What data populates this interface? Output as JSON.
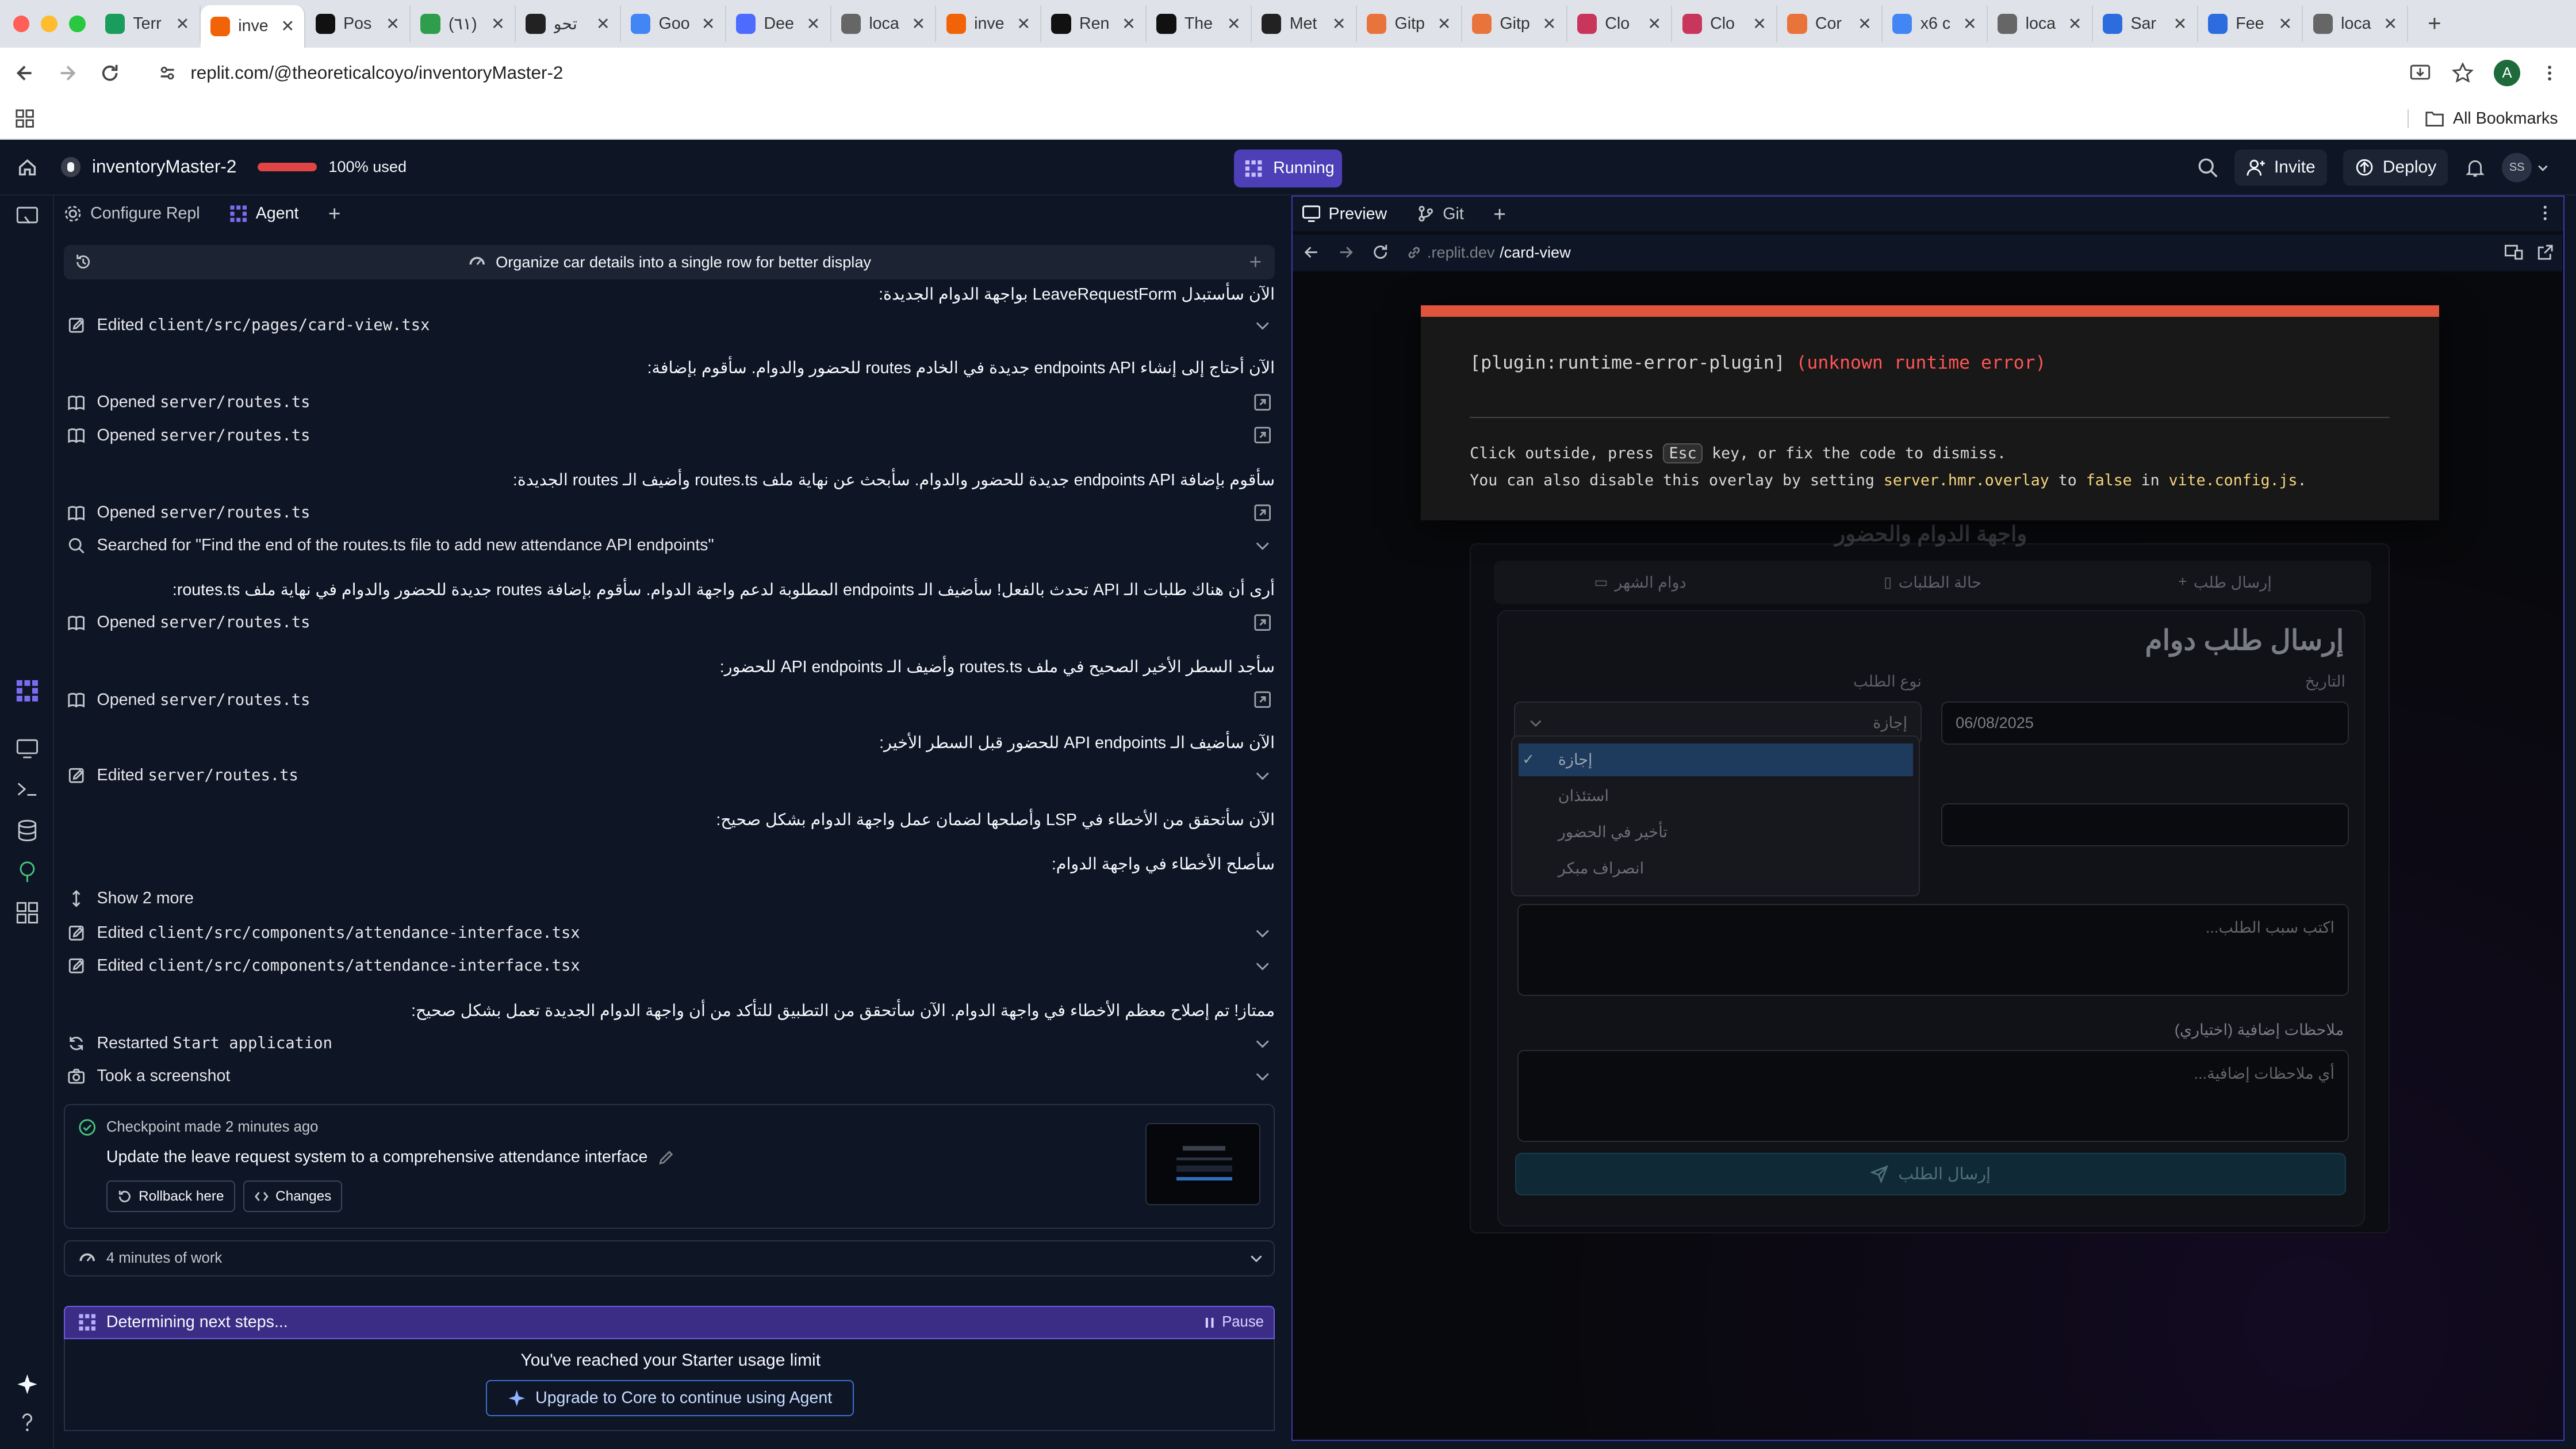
{
  "browser": {
    "tabs": [
      {
        "label": "Terr",
        "color": "#1a9d5c"
      },
      {
        "label": "inve",
        "color": "#f26207",
        "active": true
      },
      {
        "label": "Pos",
        "color": "#111111"
      },
      {
        "label": "(٦١)",
        "color": "#2e9e4c"
      },
      {
        "label": "تحو",
        "color": "#222222"
      },
      {
        "label": "Goo",
        "color": "#4285f4"
      },
      {
        "label": "Dee",
        "color": "#4d6bfe"
      },
      {
        "label": "loca",
        "color": "#666666"
      },
      {
        "label": "inve",
        "color": "#f26207"
      },
      {
        "label": "Ren",
        "color": "#111111"
      },
      {
        "label": "The",
        "color": "#111111"
      },
      {
        "label": "Met",
        "color": "#222222"
      },
      {
        "label": "Gitp",
        "color": "#e8743b"
      },
      {
        "label": "Gitp",
        "color": "#e8743b"
      },
      {
        "label": "Clo",
        "color": "#c8365b"
      },
      {
        "label": "Clo",
        "color": "#c8365b"
      },
      {
        "label": "Cor",
        "color": "#e8743b"
      },
      {
        "label": "x6 c",
        "color": "#4285f4"
      },
      {
        "label": "loca",
        "color": "#666666"
      },
      {
        "label": "Sar",
        "color": "#2d6cdf"
      },
      {
        "label": "Fee",
        "color": "#2d6cdf"
      },
      {
        "label": "loca",
        "color": "#666666"
      }
    ],
    "url": "replit.com/@theoreticalcoyo/inventoryMaster-2",
    "profile_initial": "A",
    "bookmarks_label": "All Bookmarks"
  },
  "header": {
    "project_name": "inventoryMaster-2",
    "usage": "100% used",
    "running_label": "Running",
    "invite_label": "Invite",
    "deploy_label": "Deploy",
    "avatar": "SS"
  },
  "agent": {
    "tab_config": "Configure Repl",
    "tab_agent": "Agent",
    "task_title": "Organize car details into a single row for better display",
    "items": [
      {
        "kind": "msg",
        "text": "الآن سأستبدل LeaveRequestForm بواجهة الدوام الجديدة:"
      },
      {
        "kind": "act",
        "icon": "edit",
        "label": "Edited ",
        "code": "client/src/pages/card-view.tsx",
        "right": "chevron"
      },
      {
        "kind": "msg",
        "text": "الآن أحتاج إلى إنشاء endpoints API جديدة في الخادم routes للحضور والدوام. سأقوم بإضافة:"
      },
      {
        "kind": "act",
        "icon": "book",
        "label": "Opened ",
        "code": "server/routes.ts",
        "right": "open"
      },
      {
        "kind": "act",
        "icon": "book",
        "label": "Opened ",
        "code": "server/routes.ts",
        "right": "open"
      },
      {
        "kind": "msg",
        "text": "سأقوم بإضافة endpoints API جديدة للحضور والدوام. سأبحث عن نهاية ملف routes.ts وأضيف الـ routes الجديدة:"
      },
      {
        "kind": "act",
        "icon": "book",
        "label": "Opened ",
        "code": "server/routes.ts",
        "right": "open"
      },
      {
        "kind": "act",
        "icon": "search",
        "label": "Searched for \"Find the end of the routes.ts file to add new attendance API endpoints\"",
        "code": "",
        "right": "chevron"
      },
      {
        "kind": "msg",
        "text": "أرى أن هناك طلبات الـ API تحدث بالفعل! سأضيف الـ endpoints المطلوبة لدعم واجهة الدوام. سأقوم بإضافة routes جديدة للحضور والدوام في نهاية ملف routes.ts:"
      },
      {
        "kind": "act",
        "icon": "book",
        "label": "Opened ",
        "code": "server/routes.ts",
        "right": "open"
      },
      {
        "kind": "msg",
        "text": "سأجد السطر الأخير الصحيح في ملف routes.ts وأضيف الـ API endpoints للحضور:"
      },
      {
        "kind": "act",
        "icon": "book",
        "label": "Opened ",
        "code": "server/routes.ts",
        "right": "open"
      },
      {
        "kind": "msg",
        "text": "الآن سأضيف الـ API endpoints للحضور قبل السطر الأخير:"
      },
      {
        "kind": "act",
        "icon": "edit",
        "label": "Edited ",
        "code": "server/routes.ts",
        "right": "chevron"
      },
      {
        "kind": "msg",
        "text": "الآن سأتحقق من الأخطاء في LSP وأصلحها لضمان عمل واجهة الدوام بشكل صحيح:"
      },
      {
        "kind": "msg",
        "text": "سأصلح الأخطاء في واجهة الدوام:"
      },
      {
        "kind": "act",
        "icon": "expand",
        "label": "Show 2 more",
        "code": "",
        "right": ""
      },
      {
        "kind": "act",
        "icon": "edit",
        "label": "Edited ",
        "code": "client/src/components/attendance-interface.tsx",
        "right": "chevron"
      },
      {
        "kind": "act",
        "icon": "edit",
        "label": "Edited ",
        "code": "client/src/components/attendance-interface.tsx",
        "right": "chevron"
      },
      {
        "kind": "msg",
        "text": "ممتاز! تم إصلاح معظم الأخطاء في واجهة الدوام. الآن سأتحقق من التطبيق للتأكد من أن واجهة الدوام الجديدة تعمل بشكل صحيح:"
      },
      {
        "kind": "act",
        "icon": "restart",
        "label": "Restarted ",
        "code": "Start application",
        "right": "chevron"
      },
      {
        "kind": "act",
        "icon": "camera",
        "label": "Took a screenshot",
        "code": "",
        "right": "chevron"
      }
    ],
    "checkpoint": {
      "made": "Checkpoint made 2 minutes ago",
      "title": "Update the leave request system to a comprehensive attendance interface",
      "rollback": "Rollback here",
      "changes": "Changes"
    },
    "work": "4 minutes of work",
    "status": "Determining next steps...",
    "pause": "Pause",
    "limit_text": "You've reached your Starter usage limit",
    "upgrade": "Upgrade to Core to continue using Agent"
  },
  "preview": {
    "tab_preview": "Preview",
    "tab_git": "Git",
    "url_host": ".replit.dev",
    "url_path": "/card-view",
    "error": {
      "plugin": "[plugin:runtime-error-plugin]",
      "message": "(unknown runtime error)",
      "tip_1a": "Click outside, press ",
      "tip_key": "Esc",
      "tip_1b": " key, or fix the code to dismiss.",
      "tip_2a": "You can also disable this overlay by setting ",
      "tip_2b": "server.hmr.overlay",
      "tip_2c": " to ",
      "tip_2d": "false",
      "tip_2e": " in ",
      "tip_2f": "vite.config.js",
      "tip_2g": "."
    },
    "app": {
      "heading_partial": "واجهة الدوام والحضور",
      "tabs": [
        "دوام الشهر",
        "حالة الطلبات",
        "إرسال طلب"
      ],
      "form_title": "إرسال طلب دوام",
      "type_label": "نوع الطلب",
      "type_value": "إجازة",
      "date_label": "التاريخ",
      "date_value": "06/08/2025",
      "options": [
        "إجازة",
        "استئذان",
        "تأخير في الحضور",
        "انصراف مبكر"
      ],
      "reason_placeholder": "اكتب سبب الطلب...",
      "notes_label": "ملاحظات إضافية (اختياري)",
      "notes_placeholder": "أي ملاحظات إضافية...",
      "submit": "إرسال الطلب"
    }
  }
}
